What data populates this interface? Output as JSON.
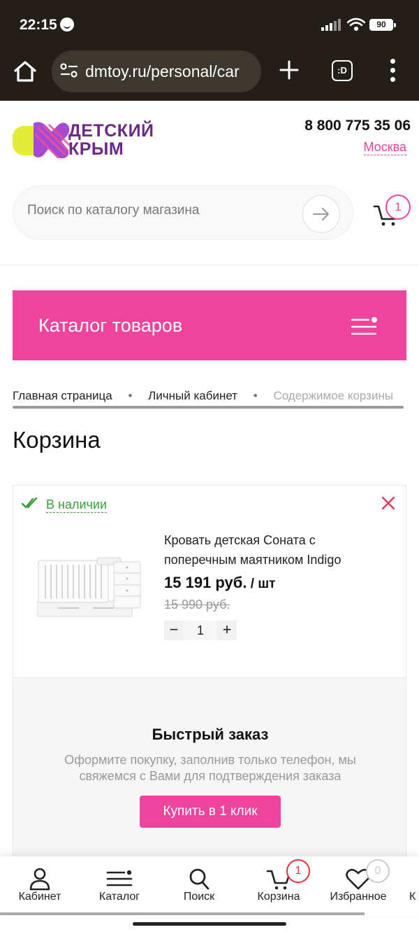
{
  "status_bar": {
    "time": "22:15",
    "battery": "90"
  },
  "browser": {
    "url": "dmtoy.ru/personal/car",
    "tabs_label": ":D"
  },
  "header": {
    "logo_line1": "ДЕТСКИЙ",
    "logo_line2": "КРЫМ",
    "phone": "8 800 775 35 06",
    "city": "Москва",
    "search_placeholder": "Поиск по каталогу магазина",
    "cart_count": "1"
  },
  "catalog_bar": {
    "label": "Каталог товаров"
  },
  "breadcrumb": [
    "Главная страница",
    "Личный кабинет",
    "Содержимое корзины"
  ],
  "breadcrumb_separator": "•",
  "page_title": "Корзина",
  "cart_item": {
    "availability": "В наличии",
    "name": "Кровать детская Соната с поперечным маятником Indigo",
    "price": "15 191 руб.",
    "price_unit": " / шт",
    "old_price": "15 990 руб.",
    "quantity": "1",
    "minus": "−",
    "plus": "+"
  },
  "quick_order": {
    "title": "Быстрый заказ",
    "description": "Оформите покупку, заполнив только телефон, мы свяжемся с Вами для подтверждения заказа",
    "button": "Купить в 1 клик"
  },
  "bottom_nav": [
    {
      "label": "Кабинет",
      "icon": "user-icon"
    },
    {
      "label": "Каталог",
      "icon": "menu-icon"
    },
    {
      "label": "Поиск",
      "icon": "search-icon"
    },
    {
      "label": "Корзина",
      "icon": "cart-icon",
      "badge": "1"
    },
    {
      "label": "Избранное",
      "icon": "heart-icon",
      "badge": "0"
    },
    {
      "label": "К",
      "icon": ""
    }
  ],
  "colors": {
    "accent": "#ee449b",
    "success": "#3a9e39",
    "cart_badge": "#d9363e",
    "logo_purple": "#6a2a86",
    "logo_yellow": "#e4ec3a",
    "browser_bg": "#231f18"
  }
}
